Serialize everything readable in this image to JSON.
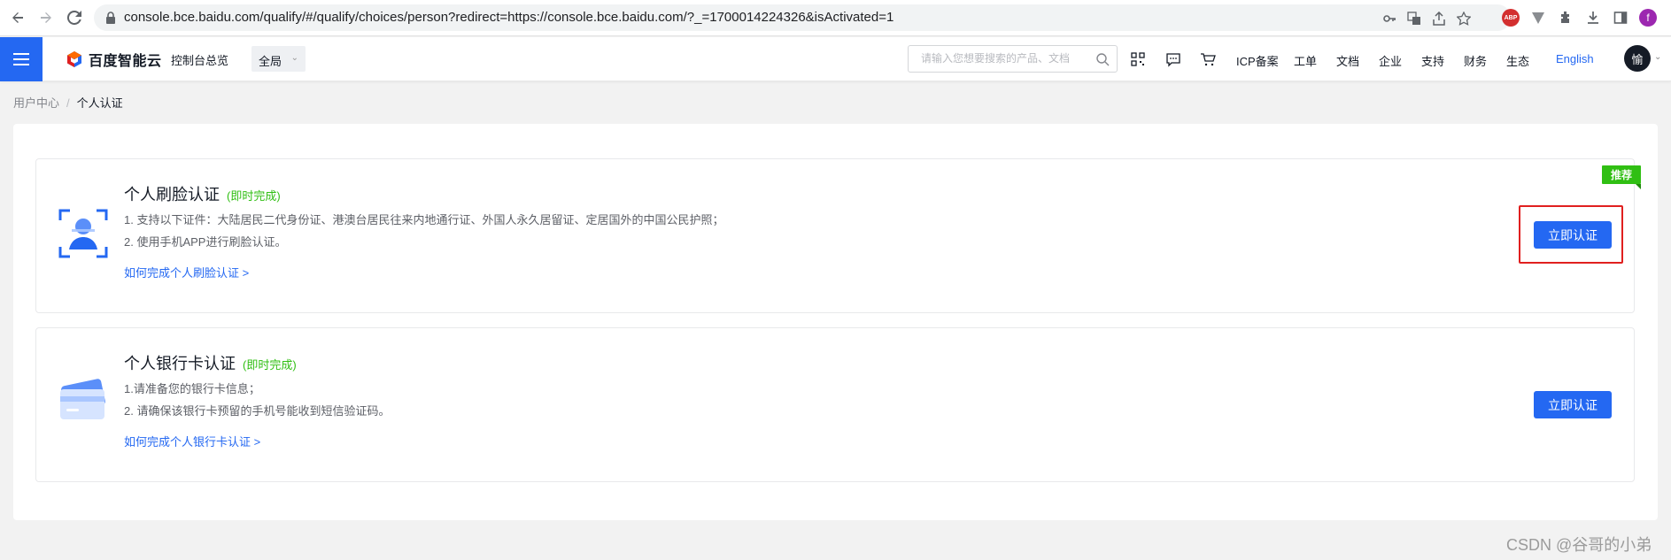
{
  "browser": {
    "url": "console.bce.baidu.com/qualify/#/qualify/choices/person?redirect=https://console.bce.baidu.com/?_=1700014224326&isActivated=1",
    "profile_initial": "f",
    "abp_label": "ABP"
  },
  "header": {
    "logo_text": "百度智能云",
    "console_overview": "控制台总览",
    "region": "全局",
    "search_placeholder": "请输入您想要搜索的产品、文档",
    "nav": [
      "ICP备案",
      "工单",
      "文档",
      "企业",
      "支持",
      "财务",
      "生态"
    ],
    "language": "English",
    "avatar_initial": "愉"
  },
  "breadcrumb": {
    "parent": "用户中心",
    "separator": "/",
    "current": "个人认证"
  },
  "cards": [
    {
      "title": "个人刷脸认证",
      "tag": "(即时完成)",
      "lines": [
        "1. 支持以下证件：大陆居民二代身份证、港澳台居民往来内地通行证、外国人永久居留证、定居国外的中国公民护照；",
        "2. 使用手机APP进行刷脸认证。"
      ],
      "help_link": "如何完成个人刷脸认证 >",
      "button": "立即认证",
      "badge": "推荐",
      "icon": "face-scan-icon"
    },
    {
      "title": "个人银行卡认证",
      "tag": "(即时完成)",
      "lines": [
        "1.请准备您的银行卡信息；",
        "2. 请确保该银行卡预留的手机号能收到短信验证码。"
      ],
      "help_link": "如何完成个人银行卡认证 >",
      "button": "立即认证",
      "icon": "bank-card-icon"
    }
  ],
  "watermark": "CSDN @谷哥的小弟",
  "colors": {
    "primary": "#2468f2",
    "success": "#30bf13",
    "highlight": "#e0201f"
  }
}
